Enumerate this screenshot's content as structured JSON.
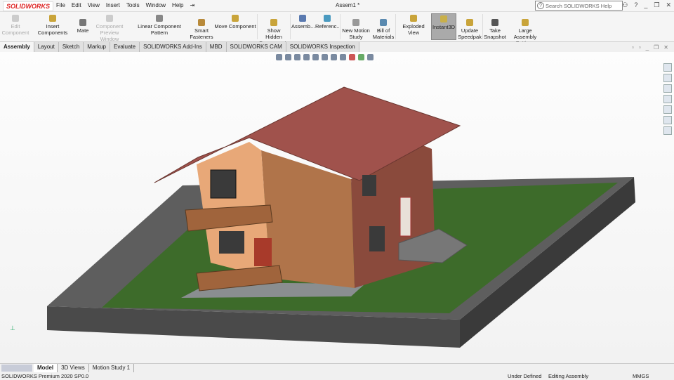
{
  "app": {
    "logo": "SOLIDWORKS",
    "title": "Assem1 *",
    "menus": [
      "File",
      "Edit",
      "View",
      "Insert",
      "Tools",
      "Window",
      "Help"
    ],
    "search_placeholder": "Search SOLIDWORKS Help"
  },
  "toolbar": {
    "items": [
      {
        "label": "Edit Component",
        "disabled": true
      },
      {
        "label": "Insert Components"
      },
      {
        "label": "Mate"
      },
      {
        "label": "Component Preview Window",
        "disabled": true
      },
      {
        "label": "Linear Component Pattern"
      },
      {
        "label": "Smart Fasteners"
      },
      {
        "label": "Move Component"
      },
      {
        "label": "Show Hidden Components"
      },
      {
        "label": "Assemb..."
      },
      {
        "label": "Referenc..."
      },
      {
        "label": "New Motion Study"
      },
      {
        "label": "Bill of Materials"
      },
      {
        "label": "Exploded View"
      },
      {
        "label": "Instant3D",
        "active": true
      },
      {
        "label": "Update Speedpak"
      },
      {
        "label": "Take Snapshot"
      },
      {
        "label": "Large Assembly Settings"
      }
    ]
  },
  "tabs": [
    "Assembly",
    "Layout",
    "Sketch",
    "Markup",
    "Evaluate",
    "SOLIDWORKS Add-Ins",
    "MBD",
    "SOLIDWORKS CAM",
    "SOLIDWORKS Inspection"
  ],
  "bottom_tabs": [
    "Model",
    "3D Views",
    "Motion Study 1"
  ],
  "status": {
    "product": "SOLIDWORKS Premium 2020 SP0.0",
    "state": "Under Defined",
    "mode": "Editing Assembly",
    "units": "MMGS"
  },
  "colors": {
    "roof": "#a0524c",
    "grass": "#3d6b2a",
    "wall": "#565656",
    "peach": "#e8a878",
    "wood": "#a8643c",
    "brick": "#8a4a3c"
  }
}
